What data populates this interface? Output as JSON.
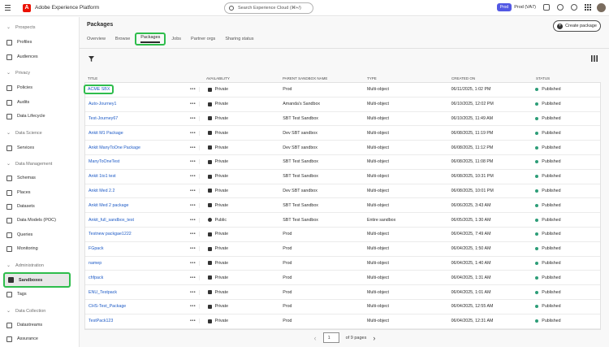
{
  "app": {
    "title": "Adobe Experience Platform",
    "logo": "A"
  },
  "search": {
    "placeholder": "Search Experience Cloud (⌘+/)"
  },
  "topbar": {
    "env_badge": "Prod",
    "org_label": "Prod (VA7)"
  },
  "sidebar": {
    "sections": [
      {
        "label": "Prospects",
        "items": [
          "Profiles",
          "Audiences"
        ]
      },
      {
        "label": "Privacy",
        "items": [
          "Policies",
          "Audits",
          "Data Lifecycle"
        ]
      },
      {
        "label": "Data Science",
        "items": [
          "Services"
        ]
      },
      {
        "label": "Data Management",
        "items": [
          "Schemas",
          "Places",
          "Datasets",
          "Data Models (POC)",
          "Queries",
          "Monitoring"
        ]
      },
      {
        "label": "Administration",
        "items": [
          "Sandboxes",
          "Tags"
        ]
      },
      {
        "label": "Data Collection",
        "items": [
          "Datastreams",
          "Assurance"
        ]
      }
    ],
    "active": "Sandboxes"
  },
  "page": {
    "title": "Packages",
    "create_label": "Create package"
  },
  "tabs": [
    "Overview",
    "Browse",
    "Packages",
    "Jobs",
    "Partner orgs",
    "Sharing status"
  ],
  "active_tab": "Packages",
  "table": {
    "headers": [
      "TITLE",
      "AVAILABILITY",
      "PARENT SANDBOX NAME",
      "TYPE",
      "CREATED ON",
      "STATUS"
    ],
    "rows": [
      [
        "ACME SBX",
        "Private",
        "Prod",
        "Multi-object",
        "06/11/2025, 1:02 PM",
        "Published"
      ],
      [
        "Auto-Journey1",
        "Private",
        "Amanda's Sandbox",
        "Multi-object",
        "06/10/2025, 12:02 PM",
        "Published"
      ],
      [
        "Test-Journey67",
        "Private",
        "SBT Test Sandbox",
        "Multi-object",
        "06/10/2025, 11:49 AM",
        "Published"
      ],
      [
        "Ankit M1 Package",
        "Private",
        "Dev SBT sandbox",
        "Multi-object",
        "06/08/2025, 11:19 PM",
        "Published"
      ],
      [
        "Ankit ManyToOne Package",
        "Private",
        "Dev SBT sandbox",
        "Multi-object",
        "06/08/2025, 11:12 PM",
        "Published"
      ],
      [
        "ManyToOneTest",
        "Private",
        "SBT Test Sandbox",
        "Multi-object",
        "06/08/2025, 11:08 PM",
        "Published"
      ],
      [
        "Ankit 1to1 test",
        "Private",
        "SBT Test Sandbox",
        "Multi-object",
        "06/08/2025, 10:31 PM",
        "Published"
      ],
      [
        "Ankit Med 2.2",
        "Private",
        "Dev SBT sandbox",
        "Multi-object",
        "06/08/2025, 10:01 PM",
        "Published"
      ],
      [
        "Ankit Med 2 package",
        "Private",
        "SBT Test Sandbox",
        "Multi-object",
        "06/06/2025, 3:43 AM",
        "Published"
      ],
      [
        "Ankit_full_sandbox_test",
        "Public",
        "SBT Test Sandbox",
        "Entire sandbox",
        "06/05/2025, 1:30 AM",
        "Published"
      ],
      [
        "Testnew packgae1222",
        "Private",
        "Prod",
        "Multi-object",
        "06/04/2025, 7:49 AM",
        "Published"
      ],
      [
        "FGpack",
        "Private",
        "Prod",
        "Multi-object",
        "06/04/2025, 1:50 AM",
        "Published"
      ],
      [
        "namep",
        "Private",
        "Prod",
        "Multi-object",
        "06/04/2025, 1:40 AM",
        "Published"
      ],
      [
        "chfpack",
        "Private",
        "Prod",
        "Multi-object",
        "06/04/2025, 1:31 AM",
        "Published"
      ],
      [
        "ENU_Testpack",
        "Private",
        "Prod",
        "Multi-object",
        "06/04/2025, 1:01 AM",
        "Published"
      ],
      [
        "CHS-Test_Package",
        "Private",
        "Prod",
        "Multi-object",
        "06/04/2025, 12:55 AM",
        "Published"
      ],
      [
        "TestPack123",
        "Private",
        "Prod",
        "Multi-object",
        "06/04/2025, 12:31 AM",
        "Published"
      ]
    ]
  },
  "pager": {
    "current": "1",
    "total_label": "of 9 pages",
    "prev": "‹",
    "next": "›"
  },
  "colors": {
    "accent_highlight": "#2ebd4c",
    "link": "#1e5bc6",
    "published": "#2d9d78",
    "prod_badge": "#5258e4"
  }
}
